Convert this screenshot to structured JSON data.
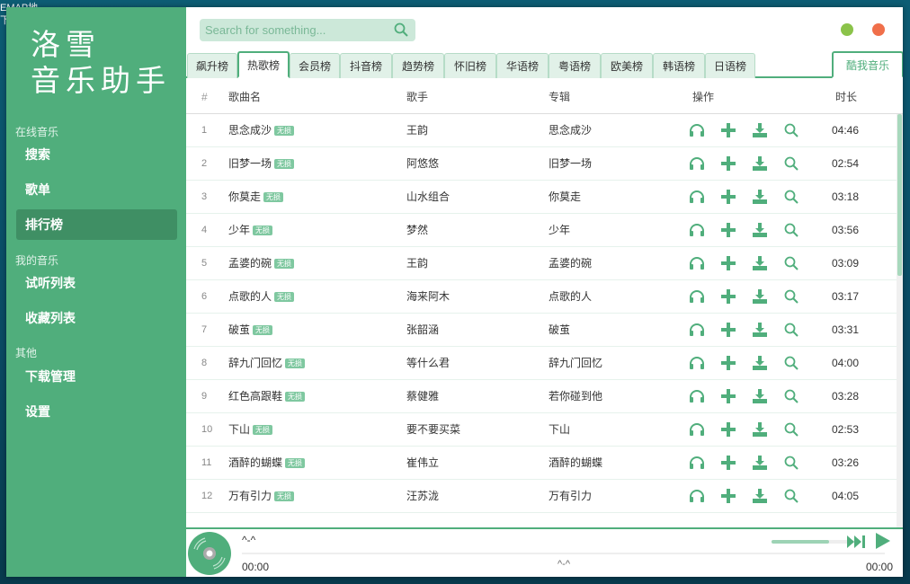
{
  "desktop": {
    "text1": "EMAP地",
    "text2": "下"
  },
  "sidebar": {
    "logo_line1": "洛雪",
    "logo_line2": "音乐助手",
    "groups": [
      {
        "label": "在线音乐"
      },
      {
        "label": "我的音乐"
      },
      {
        "label": "其他"
      }
    ],
    "items": [
      {
        "label": "搜索"
      },
      {
        "label": "歌单"
      },
      {
        "label": "排行榜"
      },
      {
        "label": "试听列表"
      },
      {
        "label": "收藏列表"
      },
      {
        "label": "下载管理"
      },
      {
        "label": "设置"
      }
    ]
  },
  "search": {
    "placeholder": "Search for something..."
  },
  "colors": {
    "accent": "#50ae7c",
    "min": "#8bc34a",
    "close": "#f06f4a"
  },
  "tabs": [
    "飙升榜",
    "热歌榜",
    "会员榜",
    "抖音榜",
    "趋势榜",
    "怀旧榜",
    "华语榜",
    "粤语榜",
    "欧美榜",
    "韩语榜",
    "日语榜"
  ],
  "source_tab": "酷我音乐",
  "table": {
    "headers": {
      "num": "#",
      "name": "歌曲名",
      "singer": "歌手",
      "album": "专辑",
      "ops": "操作",
      "dur": "时长"
    },
    "tag": "无损",
    "rows": [
      {
        "n": "1",
        "name": "思念成沙",
        "singer": "王韵",
        "album": "思念成沙",
        "dur": "04:46"
      },
      {
        "n": "2",
        "name": "旧梦一场",
        "singer": "阿悠悠",
        "album": "旧梦一场",
        "dur": "02:54"
      },
      {
        "n": "3",
        "name": "你莫走",
        "singer": "山水组合",
        "album": "你莫走",
        "dur": "03:18"
      },
      {
        "n": "4",
        "name": "少年",
        "singer": "梦然",
        "album": "少年",
        "dur": "03:56"
      },
      {
        "n": "5",
        "name": "孟婆的碗",
        "singer": "王韵",
        "album": "孟婆的碗",
        "dur": "03:09"
      },
      {
        "n": "6",
        "name": "点歌的人",
        "singer": "海来阿木",
        "album": "点歌的人",
        "dur": "03:17"
      },
      {
        "n": "7",
        "name": "破茧",
        "singer": "张韶涵",
        "album": "破茧",
        "dur": "03:31"
      },
      {
        "n": "8",
        "name": "辞九门回忆",
        "singer": "等什么君",
        "album": "辞九门回忆",
        "dur": "04:00"
      },
      {
        "n": "9",
        "name": "红色高跟鞋",
        "singer": "蔡健雅",
        "album": "若你碰到他",
        "dur": "03:28"
      },
      {
        "n": "10",
        "name": "下山",
        "singer": "要不要买菜",
        "album": "下山",
        "dur": "02:53"
      },
      {
        "n": "11",
        "name": "酒醉的蝴蝶",
        "singer": "崔伟立",
        "album": "酒醉的蝴蝶",
        "dur": "03:26"
      },
      {
        "n": "12",
        "name": "万有引力",
        "singer": "汪苏泷",
        "album": "万有引力",
        "dur": "04:05"
      }
    ]
  },
  "player": {
    "title": "^-^",
    "subtitle": "^-^",
    "time_current": "00:00",
    "time_total": "00:00",
    "volume": 0.7,
    "progress": 0
  }
}
